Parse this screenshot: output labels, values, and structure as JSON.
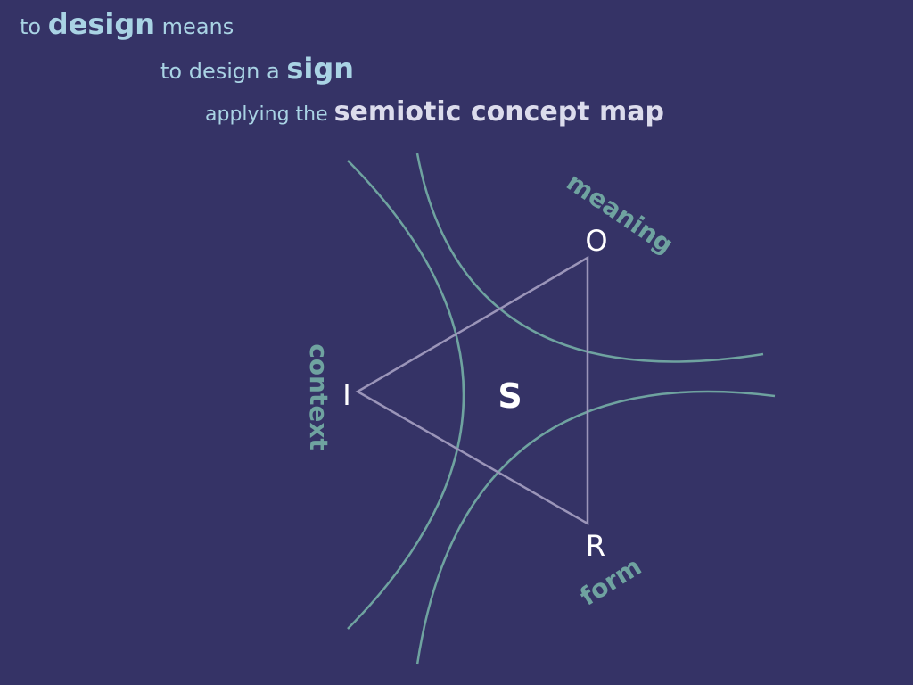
{
  "heading": {
    "line1": {
      "pre": "to ",
      "emph": "design",
      "post": " means"
    },
    "line2": {
      "pre": "to design a ",
      "emph": "sign"
    },
    "line3": {
      "pre": "applying the ",
      "emph": "semiotic concept map"
    }
  },
  "diagram": {
    "vertices": {
      "object": "O",
      "interpretant": "I",
      "representamen": "R",
      "sign": "S"
    },
    "dimensions": {
      "meaning": "meaning",
      "context": "context",
      "form": "form"
    }
  },
  "colors": {
    "background": "#353366",
    "heading_text": "#a9d3e4",
    "curves": "#6fa3a0",
    "triangle": "#9b95b9",
    "vertex_text": "#ffffff",
    "dimension_text": "#6fa3a0"
  }
}
